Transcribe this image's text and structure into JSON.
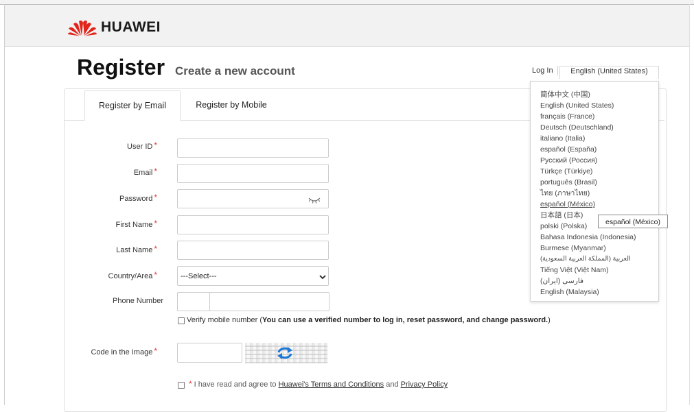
{
  "brand": {
    "name": "HUAWEI",
    "logo_icon": "huawei-petal-logo-icon",
    "color": "#e1231a"
  },
  "page": {
    "title": "Register",
    "subtitle": "Create a new account"
  },
  "header_links": {
    "login": "Log In",
    "current_language": "English (United States)"
  },
  "language_menu": {
    "items": [
      "简体中文 (中国)",
      "English (United States)",
      "français (France)",
      "Deutsch (Deutschland)",
      "italiano (Italia)",
      "español (España)",
      "Русский (Россия)",
      "Türkçe (Türkiye)",
      "português (Brasil)",
      "ไทย (ภาษาไทย)",
      "español (México)",
      "日本語 (日本)",
      "polski (Polska)",
      "Bahasa Indonesia (Indonesia)",
      "Burmese (Myanmar)",
      "العربية (المملكة العربية السعودية)",
      "Tiếng Việt (Việt Nam)",
      "فارسی (ایران)",
      "English (Malaysia)"
    ],
    "hovered_index": 10,
    "tooltip": "español (México)"
  },
  "tabs": [
    {
      "label": "Register by Email",
      "active": true
    },
    {
      "label": "Register by Mobile",
      "active": false
    }
  ],
  "form": {
    "required_mark": "*",
    "fields": {
      "user_id": {
        "label": "User ID",
        "value": ""
      },
      "email": {
        "label": "Email",
        "value": ""
      },
      "password": {
        "label": "Password",
        "value": "",
        "toggle_icon": "eye-closed-icon"
      },
      "first_name": {
        "label": "First Name",
        "value": ""
      },
      "last_name": {
        "label": "Last Name",
        "value": ""
      },
      "country": {
        "label": "Country/Area",
        "selected": "---Select---"
      },
      "phone": {
        "label": "Phone Number",
        "code": "",
        "number": ""
      },
      "captcha": {
        "label": "Code in the Image",
        "value": "",
        "refresh_icon": "refresh-icon"
      }
    },
    "verify_mobile": {
      "checked": false,
      "label": "Verify mobile number (",
      "bold": "You can use a verified number to log in, reset password, and change password.",
      "close": ")"
    },
    "agreement": {
      "checked": false,
      "prefix": "I have read and agree to ",
      "terms_link": "Huawei's Terms and Conditions",
      "middle": " and ",
      "privacy_link": "Privacy Policy"
    }
  },
  "colors": {
    "required": "#e53935",
    "captcha_icon": "#1e78d6"
  }
}
